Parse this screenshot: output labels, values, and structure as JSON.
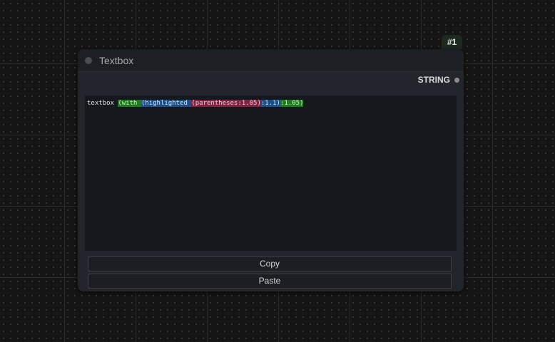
{
  "node": {
    "id_badge": "#1",
    "title": "Textbox",
    "output_label": "STRING",
    "text_segments": [
      {
        "text": "textbox ",
        "style": "plain"
      },
      {
        "text": "(with ",
        "style": "green"
      },
      {
        "text": "(highlighted ",
        "style": "blue"
      },
      {
        "text": "(parentheses:1.05)",
        "style": "red"
      },
      {
        "text": ":1.1)",
        "style": "blue"
      },
      {
        "text": ":1.05)",
        "style": "green"
      }
    ],
    "copy_label": "Copy",
    "paste_label": "Paste"
  },
  "colors": {
    "highlight_green": "#1f7a1f",
    "highlight_blue": "#1d4f86",
    "highlight_red": "#7e2440"
  }
}
